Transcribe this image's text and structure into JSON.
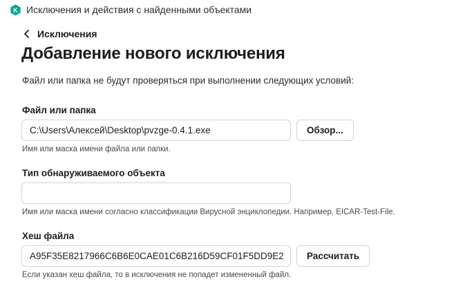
{
  "window": {
    "title": "Исключения и действия с найденными объектами",
    "logo_icon": "kaspersky-k-hexagon",
    "logo_color": "#00a88e"
  },
  "nav": {
    "back_label": "Исключения",
    "back_icon": "chevron-left-icon"
  },
  "page": {
    "title": "Добавление нового исключения",
    "description": "Файл или папка не будут проверяться при выполнении следующих условий:"
  },
  "file_or_folder": {
    "label": "Файл или папка",
    "value": "C:\\Users\\Алексей\\Desktop\\pvzge-0.4.1.exe",
    "browse_label": "Обзор...",
    "hint": "Имя или маска имени файла или папки."
  },
  "object_type": {
    "label": "Тип обнаруживаемого объекта",
    "value": "",
    "hint": "Имя или маска имени согласно классификации Вирусной энциклопедии. Например, EICAR-Test-File."
  },
  "file_hash": {
    "label": "Хеш файла",
    "value": "A95F35E8217966C6B6E0CAE01C6B216D59CF01F5DD9E2",
    "calculate_label": "Рассчитать",
    "hint": "Если указан хеш файла, то в исключения не попадет измененный файл."
  }
}
